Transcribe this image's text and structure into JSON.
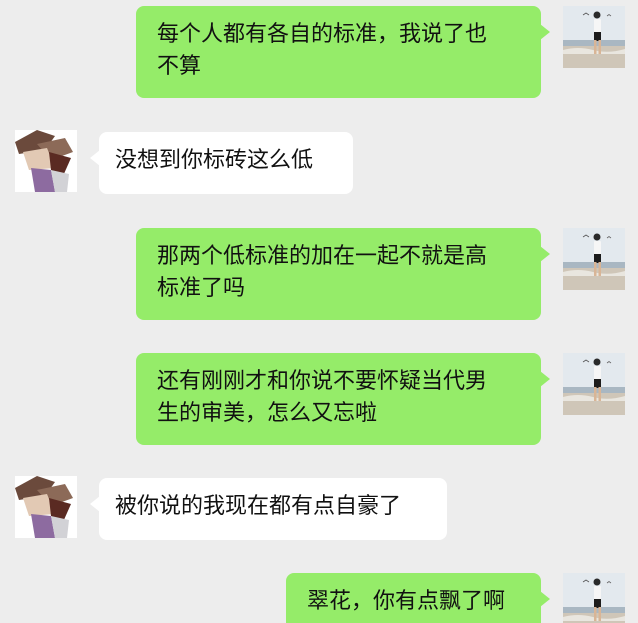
{
  "messages": [
    {
      "side": "out",
      "lines": [
        "每个人都有各自的标准，我说了也",
        "不算"
      ]
    },
    {
      "side": "in",
      "lines": [
        "没想到你标砖这么低"
      ]
    },
    {
      "side": "out",
      "lines": [
        "那两个低标准的加在一起不就是高",
        "标准了吗"
      ]
    },
    {
      "side": "out",
      "lines": [
        "还有刚刚才和你说不要怀疑当代男",
        "生的审美，怎么又忘啦"
      ]
    },
    {
      "side": "in",
      "lines": [
        "被你说的我现在都有点自豪了"
      ]
    },
    {
      "side": "out",
      "lines": [
        "翠花，你有点飘了啊"
      ]
    }
  ],
  "colors": {
    "background": "#ededed",
    "sent_bubble": "#95ec69",
    "received_bubble": "#ffffff"
  },
  "avatars": {
    "self": "beach-photo-avatar",
    "contact": "abstract-shapes-avatar"
  }
}
